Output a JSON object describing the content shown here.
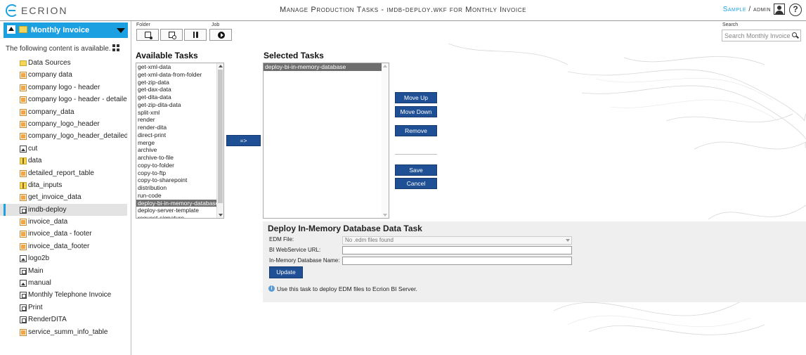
{
  "app": {
    "logo_text": "ECRION",
    "title": "Manage Production Tasks - imdb-deploy.wkf for Monthly Invoice",
    "user_workspace": "Sample",
    "user_sep": " / ",
    "user_name": "admin",
    "help_glyph": "?"
  },
  "sidebar": {
    "folder_name": "Monthly Invoice",
    "info_text": "The following content is available.",
    "items": [
      {
        "label": "Data Sources",
        "icon": "folder-icon"
      },
      {
        "label": "company data",
        "icon": "document-icon"
      },
      {
        "label": "company logo - header",
        "icon": "document-icon"
      },
      {
        "label": "company logo - header - detailed rep...",
        "icon": "document-icon"
      },
      {
        "label": "company_data",
        "icon": "document-icon"
      },
      {
        "label": "company_logo_header",
        "icon": "document-icon"
      },
      {
        "label": "company_logo_header_detailed_report",
        "icon": "document-icon"
      },
      {
        "label": "cut",
        "icon": "image-icon"
      },
      {
        "label": "data",
        "icon": "zip-icon"
      },
      {
        "label": "detailed_report_table",
        "icon": "document-icon"
      },
      {
        "label": "dita_inputs",
        "icon": "zip-icon"
      },
      {
        "label": "get_invoice_data",
        "icon": "document-icon"
      },
      {
        "label": "imdb-deploy",
        "icon": "workflow-icon"
      },
      {
        "label": "invoice_data",
        "icon": "document-icon"
      },
      {
        "label": "invoice_data - footer",
        "icon": "document-icon"
      },
      {
        "label": "invoice_data_footer",
        "icon": "document-icon"
      },
      {
        "label": "logo2b",
        "icon": "image-icon"
      },
      {
        "label": "Main",
        "icon": "workflow-icon"
      },
      {
        "label": "manual",
        "icon": "image-icon"
      },
      {
        "label": "Monthly Telephone Invoice",
        "icon": "workflow-icon"
      },
      {
        "label": "Print",
        "icon": "workflow-icon"
      },
      {
        "label": "RenderDITA",
        "icon": "workflow-icon"
      },
      {
        "label": "service_summ_info_table",
        "icon": "document-icon"
      }
    ],
    "selected_item": "imdb-deploy"
  },
  "toolbar": {
    "folder_label": "Folder",
    "job_label": "Job",
    "search_label": "Search",
    "search_placeholder": "Search Monthly Invoice"
  },
  "available": {
    "heading": "Available Tasks",
    "options": [
      "get-xml-data",
      "get-xml-data-from-folder",
      "get-zip-data",
      "get-dax-data",
      "get-dita-data",
      "get-zip-dita-data",
      "split-xml",
      "render",
      "render-dita",
      "direct-print",
      "merge",
      "archive",
      "archive-to-file",
      "copy-to-folder",
      "copy-to-ftp",
      "copy-to-sharepoint",
      "distribution",
      "run-code",
      "deploy-bi-in-memory-database",
      "deploy-server-template",
      "request-signature"
    ],
    "selected": "deploy-bi-in-memory-database"
  },
  "add_button_label": "=>",
  "selected": {
    "heading": "Selected Tasks",
    "options": [
      "deploy-bi-in-memory-database"
    ]
  },
  "actions": {
    "move_up": "Move Up",
    "move_down": "Move Down",
    "remove": "Remove",
    "save": "Save",
    "cancel": "Cancel"
  },
  "task_panel": {
    "title": "Deploy In-Memory Database Data Task",
    "edm_label": "EDM File:",
    "edm_value": "No .edm files found",
    "url_label": "BI WebService URL:",
    "url_value": "",
    "db_label": "In-Memory Database Name:",
    "db_value": "",
    "update_label": "Update",
    "info_text": "Use this task to deploy EDM files to Ecrion BI Server."
  },
  "colors": {
    "accent": "#1ba1e2",
    "button_blue": "#1f4f94",
    "selected_option": "#6e6e6e"
  }
}
